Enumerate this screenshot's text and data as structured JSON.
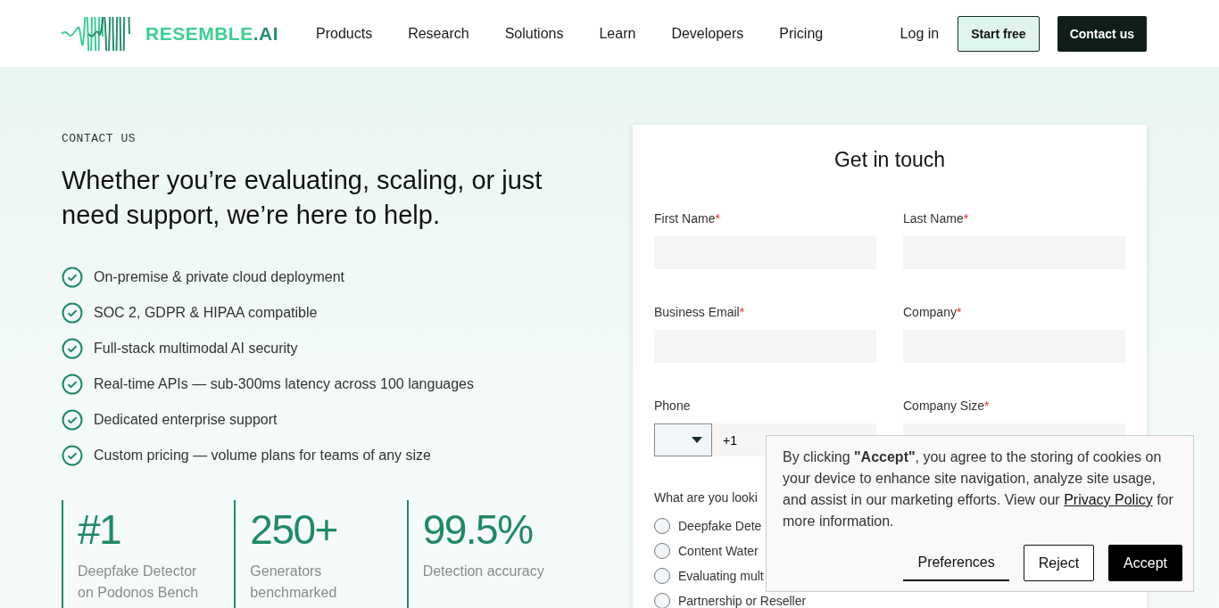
{
  "header": {
    "logo": {
      "text": "RESEMBLE",
      "suffix": ".AI"
    },
    "nav": [
      "Products",
      "Research",
      "Solutions",
      "Learn",
      "Developers",
      "Pricing"
    ],
    "login": "Log in",
    "start_free": "Start free",
    "contact": "Contact us"
  },
  "hero": {
    "eyebrow": "CONTACT US",
    "heading": "Whether you’re evaluating, scaling, or just need support, we’re here to help.",
    "features": [
      "On-premise & private cloud deployment",
      "SOC 2, GDPR & HIPAA compatible",
      "Full-stack multimodal AI security",
      "Real-time APIs — sub-300ms latency across 100 languages",
      "Dedicated enterprise support",
      "Custom pricing — volume plans for teams of any size"
    ],
    "stats": [
      {
        "value": "#1",
        "label": "Deepfake Detector on Podonos Bench"
      },
      {
        "value": "250+",
        "label": "Generators benchmarked"
      },
      {
        "value": "99.5%",
        "label": "Detection accuracy"
      }
    ]
  },
  "form": {
    "title": "Get in touch",
    "required_mark": "*",
    "fields": [
      {
        "label": "First Name",
        "required": true
      },
      {
        "label": "Last Name",
        "required": true
      },
      {
        "label": "Business Email",
        "required": true
      },
      {
        "label": "Company",
        "required": true
      }
    ],
    "phone": {
      "label": "Phone",
      "required": false,
      "value": "+1"
    },
    "company_size": {
      "label": "Company Size",
      "required": true
    },
    "question": "What are you looki",
    "options": [
      {
        "label": "Deepfake Dete",
        "selected": false
      },
      {
        "label": "Content Water",
        "selected": false
      },
      {
        "label": "Evaluating mult",
        "selected": false
      },
      {
        "label": "Partnership or Reseller",
        "selected": false
      }
    ]
  },
  "cookie_banner": {
    "text": "By clicking **\"Accept\"**, you agree to the storing of cookies on your device to enhance site navigation, analyze site usage, and assist in our marketing efforts. View our",
    "link": "Privacy Policy",
    "after": "for more information.",
    "buttons": [
      "Preferences",
      "Reject",
      "Accept"
    ]
  }
}
